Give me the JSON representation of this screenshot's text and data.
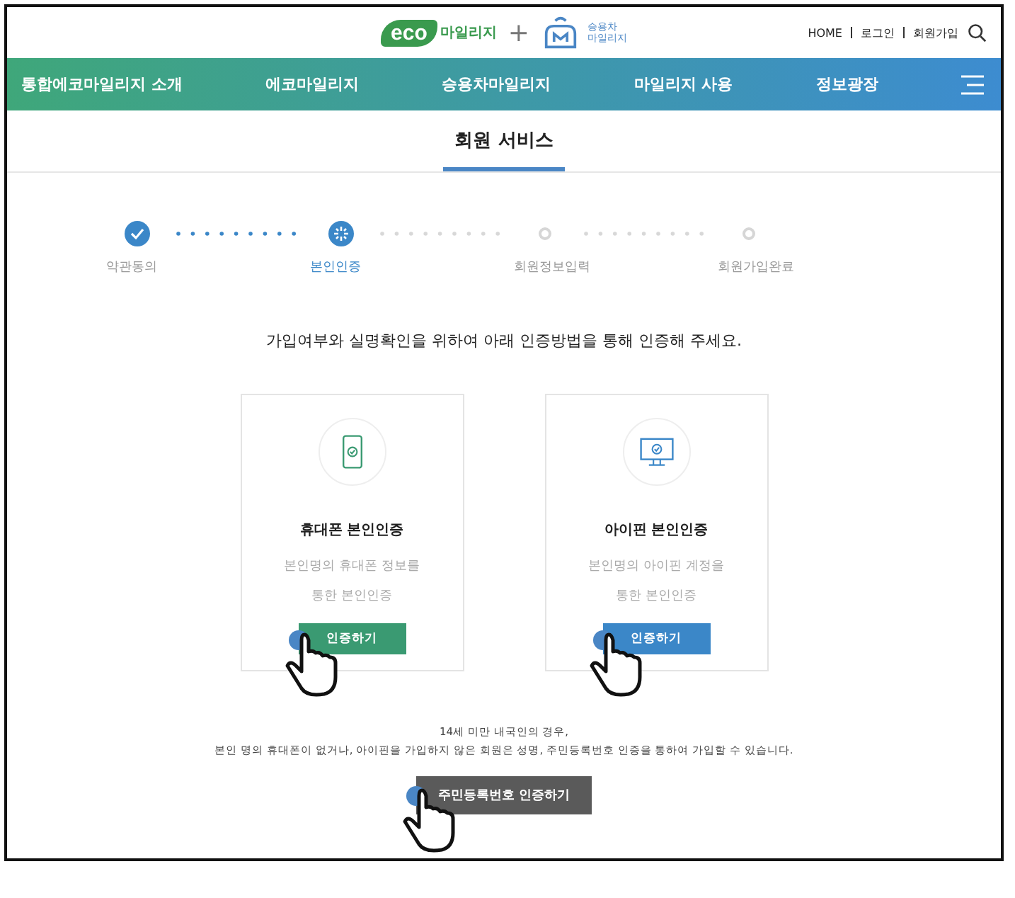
{
  "header": {
    "logo_eco": "eco",
    "logo_eco_sub": "마일리지",
    "logo_plus": "+",
    "logo_car": [
      "승용차",
      "마일리지"
    ],
    "links": [
      "HOME",
      "로그인",
      "회원가입"
    ]
  },
  "nav": {
    "items": [
      "통합에코마일리지 소개",
      "에코마일리지",
      "승용차마일리지",
      "마일리지 사용",
      "정보광장"
    ]
  },
  "page_title": "회원 서비스",
  "steps": [
    {
      "label": "약관동의",
      "done": true,
      "selected": false
    },
    {
      "label": "본인인증",
      "done": false,
      "selected": true
    },
    {
      "label": "회원정보입력",
      "done": false,
      "selected": false
    },
    {
      "label": "회원가입완료",
      "done": false,
      "selected": false
    }
  ],
  "instruction": "가입여부와 실명확인을 위하여 아래 인증방법을 통해 인증해 주세요.",
  "methods": [
    {
      "kind": "phone",
      "title": "휴대폰 본인인증",
      "description": "본인명의 휴대폰 정보를 통한 본인인증",
      "button": "인증하기",
      "color": "#3a9a72"
    },
    {
      "kind": "monitor",
      "title": "아이핀 본인인증",
      "description": "본인명의 아이핀 계정을 통한 본인인증",
      "button": "인증하기",
      "color": "#3b87c8"
    }
  ],
  "notes": [
    "14세 미만 내국인의 경우,",
    "본인 명의 휴대폰이 없거나, 아이핀을 가입하지 않은 회원은 성명, 주민등록번호 인증을 통하여 가입할 수 있습니다."
  ],
  "resident_button": "주민등록번호 인증하기"
}
